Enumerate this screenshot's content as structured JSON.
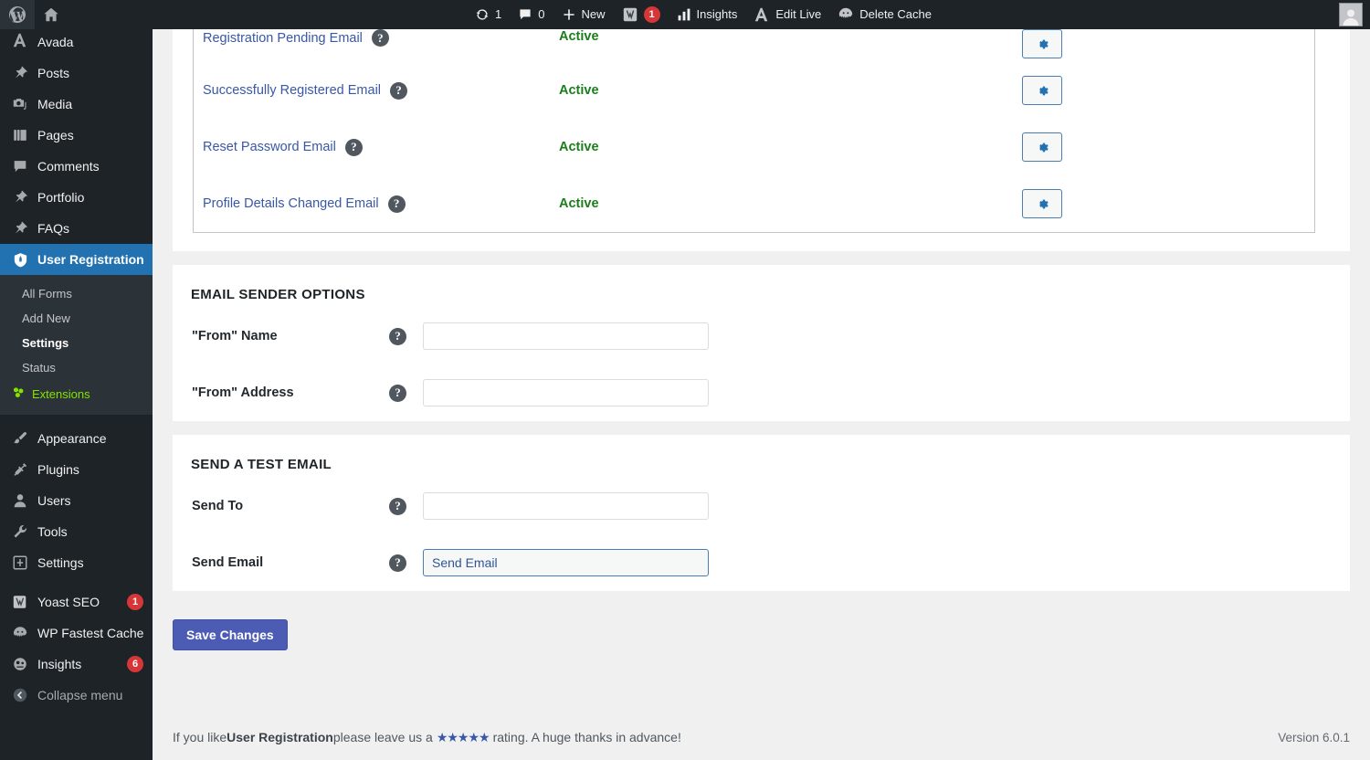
{
  "adminbar": {
    "wp_logo_icon": "wordpress-logo-icon",
    "site_name_icon": "home-icon",
    "updates": {
      "icon": "updates-icon",
      "count": "1"
    },
    "comments": {
      "icon": "comment-bubble-icon",
      "count": "0"
    },
    "new": {
      "icon": "plus-icon",
      "label": "New"
    },
    "yoast": {
      "icon": "yoast-seo-icon",
      "badge": "1"
    },
    "insights": {
      "icon": "bar-chart-icon",
      "label": "Insights"
    },
    "edit_live": {
      "icon": "avada-icon",
      "label": "Edit Live"
    },
    "delete_cache": {
      "icon": "wp-fastest-cache-icon",
      "label": "Delete Cache"
    },
    "avatar": "user-avatar"
  },
  "sidebar": {
    "items": [
      {
        "label": "Avada",
        "icon": "avada-icon",
        "clipped": true
      },
      {
        "label": "Posts",
        "icon": "pin-icon"
      },
      {
        "label": "Media",
        "icon": "camera-icon"
      },
      {
        "label": "Pages",
        "icon": "pages-icon"
      },
      {
        "label": "Comments",
        "icon": "comment-bubble-icon"
      },
      {
        "label": "Portfolio",
        "icon": "pin-icon"
      },
      {
        "label": "FAQs",
        "icon": "pin-icon"
      },
      {
        "label": "User Registration",
        "icon": "user-registration-icon",
        "current": true
      },
      {
        "label": "Appearance",
        "icon": "paintbrush-icon"
      },
      {
        "label": "Plugins",
        "icon": "plug-icon"
      },
      {
        "label": "Users",
        "icon": "user-icon"
      },
      {
        "label": "Tools",
        "icon": "wrench-icon"
      },
      {
        "label": "Settings",
        "icon": "settings-sliders-icon"
      },
      {
        "label": "Yoast SEO",
        "icon": "yoast-seo-icon",
        "badge": "1"
      },
      {
        "label": "WP Fastest Cache",
        "icon": "wp-fastest-cache-icon"
      },
      {
        "label": "Insights",
        "icon": "monsterinsights-icon",
        "badge": "6"
      }
    ],
    "submenu": [
      {
        "label": "All Forms"
      },
      {
        "label": "Add New"
      },
      {
        "label": "Settings",
        "current": true
      },
      {
        "label": "Status"
      },
      {
        "label": "Extensions",
        "accent": true,
        "icon": "extensions-icon"
      }
    ],
    "collapse": {
      "label": "Collapse menu",
      "icon": "collapse-arrow-icon"
    }
  },
  "email_table": {
    "rows": [
      {
        "name": "Registration Pending Email",
        "status": "Active",
        "help": "?",
        "action_icon": "gear-icon"
      },
      {
        "name": "Successfully Registered Email",
        "status": "Active",
        "help": "?",
        "action_icon": "gear-icon"
      },
      {
        "name": "Reset Password Email",
        "status": "Active",
        "help": "?",
        "action_icon": "gear-icon"
      },
      {
        "name": "Profile Details Changed Email",
        "status": "Active",
        "help": "?",
        "action_icon": "gear-icon"
      }
    ]
  },
  "sender_options": {
    "title": "EMAIL SENDER OPTIONS",
    "fields": [
      {
        "label": "\"From\" Name",
        "help": "?",
        "value": "",
        "placeholder": ""
      },
      {
        "label": "\"From\" Address",
        "help": "?",
        "value": "",
        "placeholder": ""
      }
    ]
  },
  "test_email": {
    "title": "SEND A TEST EMAIL",
    "send_to": {
      "label": "Send To",
      "help": "?",
      "value": "",
      "placeholder": ""
    },
    "send_email": {
      "label": "Send Email",
      "help": "?",
      "button_label": "Send Email"
    }
  },
  "save": {
    "label": "Save Changes"
  },
  "footer": {
    "text_before": "If you like ",
    "plugin_name": "User Registration",
    "text_middle": " please leave us a ",
    "stars": "★★★★★",
    "text_after": " rating. A huge thanks in advance!",
    "version": "Version 6.0.1"
  },
  "colors": {
    "admin_bar": "#1d2327",
    "sidebar": "#1d2327",
    "current_menu": "#2271b1",
    "link_blue": "#3858a7",
    "active_green": "#1a7e1a",
    "extensions_green": "#83e300",
    "badge_red": "#d63638",
    "save_button": "#4c5cb5",
    "page_background": "#f0f0f1"
  }
}
